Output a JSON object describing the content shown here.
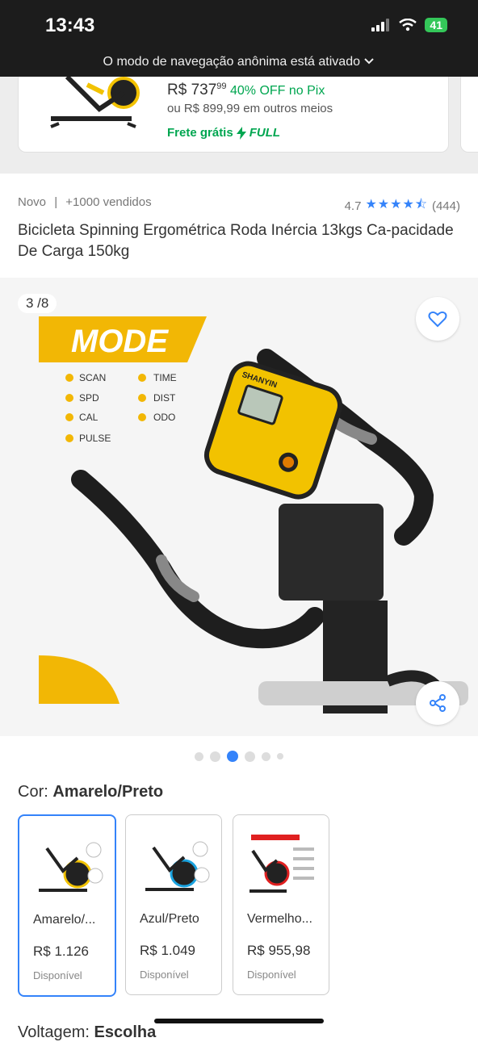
{
  "status_bar": {
    "time": "13:43",
    "battery": "41"
  },
  "incognito_banner": "O modo de navegação anônima está ativado",
  "top_card": {
    "currency": "R$",
    "price_int": "737",
    "price_cents": "99",
    "discount": "40% OFF no Pix",
    "alt_price": "ou R$ 899,99 em outros meios",
    "shipping": "Frete grátis",
    "full_label": "FULL"
  },
  "product": {
    "condition": "Novo",
    "sold": "+1000 vendidos",
    "rating": "4.7",
    "reviews": "(444)",
    "title": "Bicicleta Spinning Ergométrica Roda Inércia 13kgs Ca-pacidade De Carga 150kg"
  },
  "gallery": {
    "counter": "3 /8",
    "banner_title": "MODE",
    "modes_left": [
      "SCAN",
      "SPD",
      "CAL",
      "PULSE"
    ],
    "modes_right": [
      "TIME",
      "DIST",
      "ODO"
    ],
    "brand": "SHANYIN",
    "current_dot": 3,
    "dot_count": 6
  },
  "color_section": {
    "label": "Cor:",
    "value": "Amarelo/Preto"
  },
  "variants": [
    {
      "name": "Amarelo/...",
      "price": "R$ 1.126",
      "status": "Disponível",
      "accent": "#f2c200",
      "selected": true
    },
    {
      "name": "Azul/Preto",
      "price": "R$ 1.049",
      "status": "Disponível",
      "accent": "#1aa3e0",
      "selected": false
    },
    {
      "name": "Vermelho...",
      "price": "R$ 955,98",
      "status": "Disponível",
      "accent": "#e02020",
      "selected": false
    }
  ],
  "voltage_section": {
    "label": "Voltagem:",
    "value": "Escolha"
  },
  "colors": {
    "accent_blue": "#3483fa",
    "green": "#00a650",
    "yellow": "#f2c200"
  }
}
